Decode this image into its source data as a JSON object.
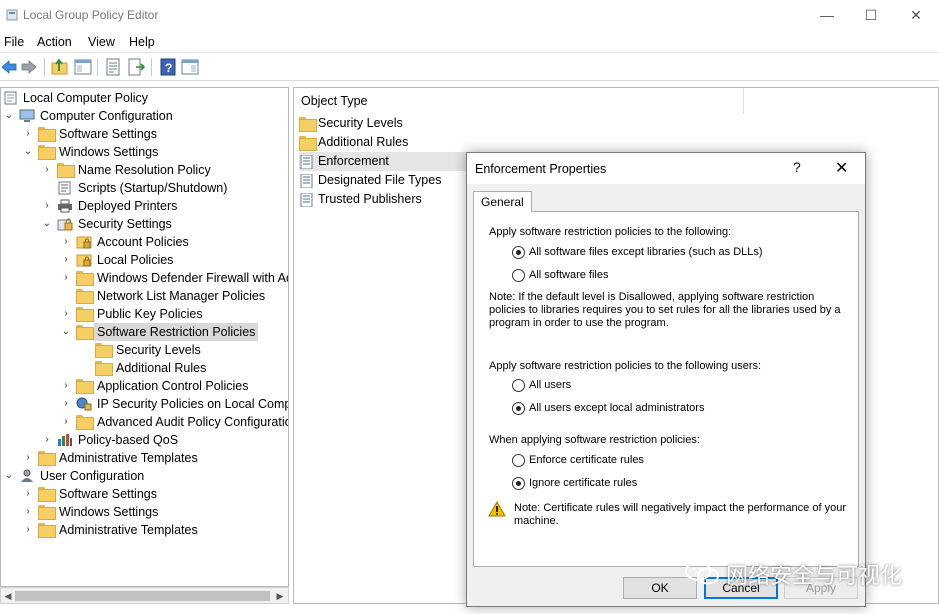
{
  "window": {
    "title": "Local Group Policy Editor"
  },
  "menu": [
    "File",
    "Action",
    "View",
    "Help"
  ],
  "tree": [
    {
      "label": "Local Computer Policy",
      "icon": "policy-icon",
      "arrow": ""
    },
    {
      "label": "Computer Configuration",
      "icon": "computer-icon",
      "arrow": "expanded"
    },
    {
      "label": "Software Settings",
      "icon": "folder-icon",
      "arrow": "collapsed"
    },
    {
      "label": "Windows Settings",
      "icon": "folder-icon",
      "arrow": "expanded"
    },
    {
      "label": "Name Resolution Policy",
      "icon": "folder-icon",
      "arrow": "collapsed"
    },
    {
      "label": "Scripts (Startup/Shutdown)",
      "icon": "script-icon",
      "arrow": ""
    },
    {
      "label": "Deployed Printers",
      "icon": "printer-icon",
      "arrow": "collapsed"
    },
    {
      "label": "Security Settings",
      "icon": "security-icon",
      "arrow": "expanded"
    },
    {
      "label": "Account Policies",
      "icon": "locked-folder-icon",
      "arrow": "collapsed"
    },
    {
      "label": "Local Policies",
      "icon": "locked-folder-icon",
      "arrow": "collapsed"
    },
    {
      "label": "Windows Defender Firewall with Adv",
      "icon": "folder-icon",
      "arrow": "collapsed"
    },
    {
      "label": "Network List Manager Policies",
      "icon": "folder-icon",
      "arrow": ""
    },
    {
      "label": "Public Key Policies",
      "icon": "folder-icon",
      "arrow": "collapsed"
    },
    {
      "label": "Software Restriction Policies",
      "icon": "folder-icon",
      "arrow": "expanded",
      "selected": true
    },
    {
      "label": "Security Levels",
      "icon": "folder-icon",
      "arrow": ""
    },
    {
      "label": "Additional Rules",
      "icon": "folder-icon",
      "arrow": ""
    },
    {
      "label": "Application Control Policies",
      "icon": "folder-icon",
      "arrow": "collapsed"
    },
    {
      "label": "IP Security Policies on Local Compu",
      "icon": "ipsec-icon",
      "arrow": "collapsed"
    },
    {
      "label": "Advanced Audit Policy Configuratio",
      "icon": "folder-icon",
      "arrow": "collapsed"
    },
    {
      "label": "Policy-based QoS",
      "icon": "chart-icon",
      "arrow": "collapsed"
    },
    {
      "label": "Administrative Templates",
      "icon": "folder-icon",
      "arrow": "collapsed"
    },
    {
      "label": "User Configuration",
      "icon": "user-icon",
      "arrow": "expanded"
    },
    {
      "label": "Software Settings",
      "icon": "folder-icon",
      "arrow": "collapsed"
    },
    {
      "label": "Windows Settings",
      "icon": "folder-icon",
      "arrow": "collapsed"
    },
    {
      "label": "Administrative Templates",
      "icon": "folder-icon",
      "arrow": "collapsed"
    }
  ],
  "list": {
    "column": "Object Type",
    "items": [
      {
        "label": "Security Levels",
        "icon": "folder-icon"
      },
      {
        "label": "Additional Rules",
        "icon": "folder-icon"
      },
      {
        "label": "Enforcement",
        "icon": "policy-doc-icon",
        "selected": true
      },
      {
        "label": "Designated File Types",
        "icon": "policy-doc-icon"
      },
      {
        "label": "Trusted Publishers",
        "icon": "policy-doc-icon"
      }
    ]
  },
  "dialog": {
    "title": "Enforcement Properties",
    "help": "?",
    "tab": "General",
    "section1": "Apply software restriction policies to the following:",
    "option1a": "All software files except libraries (such as DLLs)",
    "option1b": "All software files",
    "note1": "Note:  If the default level is Disallowed, applying software restriction policies to libraries requires you to set rules for all the libraries used by a program in order to use the program.",
    "section2": "Apply software restriction policies to the following users:",
    "option2a": "All users",
    "option2b": "All users except local administrators",
    "section3": "When applying software restriction policies:",
    "option3a": "Enforce certificate rules",
    "option3b": "Ignore certificate rules",
    "note2": "Note:  Certificate rules will negatively impact the performance of your machine.",
    "ok": "OK",
    "cancel": "Cancel",
    "apply": "Apply"
  },
  "watermark": "网络安全与可视化"
}
